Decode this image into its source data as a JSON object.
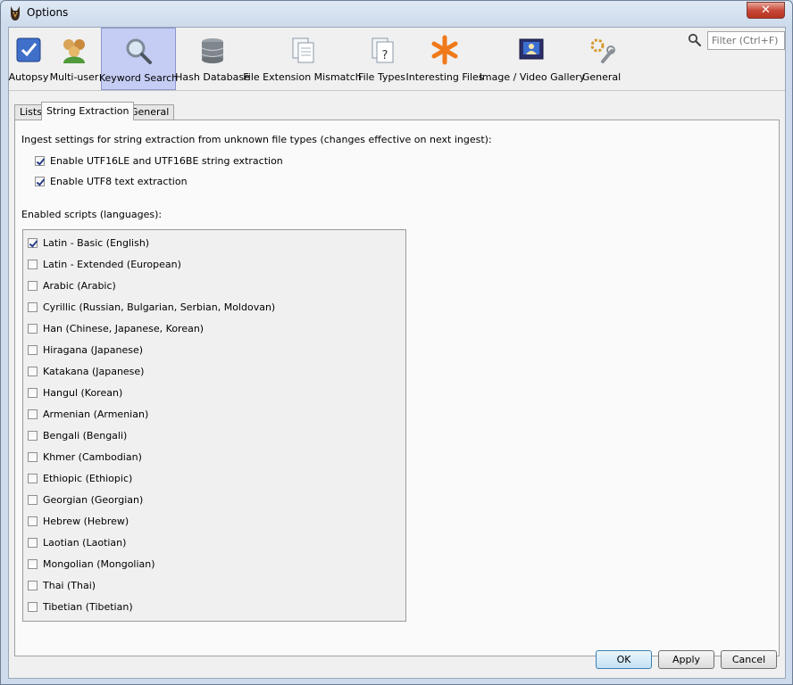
{
  "window": {
    "title": "Options",
    "close_label": "✕"
  },
  "toolbar": {
    "items": [
      {
        "label": "Autopsy",
        "icon": "autopsy-checkbox-icon"
      },
      {
        "label": "Multi-user",
        "icon": "users-icon"
      },
      {
        "label": "Keyword Search",
        "icon": "magnifier-icon",
        "selected": true
      },
      {
        "label": "Hash Database",
        "icon": "database-icon"
      },
      {
        "label": "File Extension Mismatch",
        "icon": "documents-icon"
      },
      {
        "label": "File Types",
        "icon": "file-question-icon"
      },
      {
        "label": "Interesting Files",
        "icon": "asterisk-icon"
      },
      {
        "label": "Image / Video Gallery",
        "icon": "gallery-icon"
      },
      {
        "label": "General",
        "icon": "gears-icon"
      }
    ],
    "filter_placeholder": "Filter (Ctrl+F)"
  },
  "tabs": [
    {
      "label": "Lists"
    },
    {
      "label": "String Extraction",
      "active": true
    },
    {
      "label": "General"
    }
  ],
  "string_extraction": {
    "intro": "Ingest settings for string extraction from unknown file types (changes effective on next ingest):",
    "options": [
      {
        "label": "Enable UTF16LE and UTF16BE string extraction",
        "checked": true
      },
      {
        "label": "Enable UTF8 text extraction",
        "checked": true
      }
    ],
    "scripts_heading": "Enabled scripts (languages):",
    "scripts": [
      {
        "label": "Latin - Basic (English)",
        "checked": true
      },
      {
        "label": "Latin - Extended (European)",
        "checked": false
      },
      {
        "label": "Arabic (Arabic)",
        "checked": false
      },
      {
        "label": "Cyrillic (Russian, Bulgarian, Serbian, Moldovan)",
        "checked": false
      },
      {
        "label": "Han (Chinese, Japanese, Korean)",
        "checked": false
      },
      {
        "label": "Hiragana (Japanese)",
        "checked": false
      },
      {
        "label": "Katakana (Japanese)",
        "checked": false
      },
      {
        "label": "Hangul (Korean)",
        "checked": false
      },
      {
        "label": "Armenian (Armenian)",
        "checked": false
      },
      {
        "label": "Bengali (Bengali)",
        "checked": false
      },
      {
        "label": "Khmer (Cambodian)",
        "checked": false
      },
      {
        "label": "Ethiopic (Ethiopic)",
        "checked": false
      },
      {
        "label": "Georgian (Georgian)",
        "checked": false
      },
      {
        "label": "Hebrew (Hebrew)",
        "checked": false
      },
      {
        "label": "Laotian (Laotian)",
        "checked": false
      },
      {
        "label": "Mongolian (Mongolian)",
        "checked": false
      },
      {
        "label": "Thai (Thai)",
        "checked": false
      },
      {
        "label": "Tibetian (Tibetian)",
        "checked": false
      }
    ]
  },
  "buttons": {
    "ok": "OK",
    "apply": "Apply",
    "cancel": "Cancel"
  }
}
